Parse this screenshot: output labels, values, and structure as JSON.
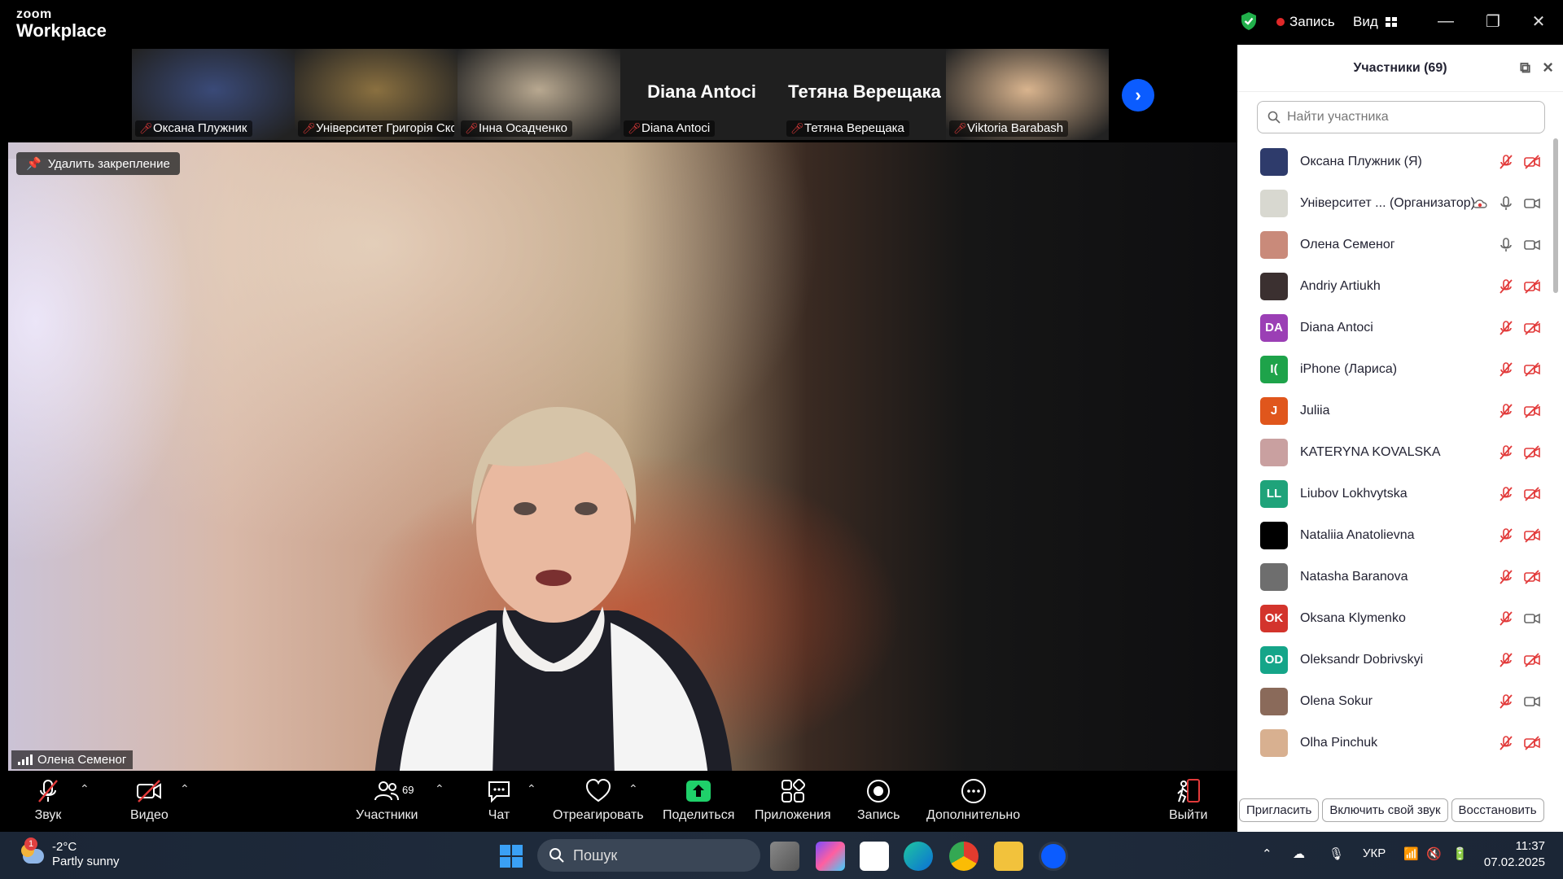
{
  "app": {
    "logo_line1": "zoom",
    "logo_line2": "Workplace",
    "record_label": "Запись",
    "view_label": "Вид"
  },
  "strip": [
    {
      "name": "Оксана Плужник",
      "kind": "photo",
      "bg": "#3a4a78"
    },
    {
      "name": "Університет Григорія Ско...",
      "kind": "photo",
      "bg": "#8a7040"
    },
    {
      "name": "Інна Осадченко",
      "kind": "photo",
      "bg": "#b8a890"
    },
    {
      "name": "Diana Antoci",
      "kind": "name",
      "big": "Diana Antoci"
    },
    {
      "name": "Тетяна Верещака",
      "kind": "name",
      "big": "Тетяна Верещака"
    },
    {
      "name": "Viktoria Barabash",
      "kind": "photo",
      "bg": "#d9b48e"
    }
  ],
  "video": {
    "unpin_label": "Удалить закрепление",
    "speaker_name": "Олена Семеног"
  },
  "toolbar": {
    "audio": "Звук",
    "video": "Видео",
    "participants": "Участники",
    "participants_count": "69",
    "chat": "Чат",
    "react": "Отреагировать",
    "share": "Поделиться",
    "apps": "Приложения",
    "record": "Запись",
    "more": "Дополнительно",
    "leave": "Выйти"
  },
  "panel": {
    "title": "Участники (69)",
    "search_placeholder": "Найти участника",
    "participants": [
      {
        "name": "Оксана Плужник (Я)",
        "initials": "",
        "color": "#2e3b6b",
        "mic": "muted",
        "cam": "off"
      },
      {
        "name": "Університет ... (Организатор)",
        "initials": "",
        "color": "#d8d8d0",
        "mic": "on",
        "cam": "on",
        "rec": true
      },
      {
        "name": "Олена Семеног",
        "initials": "",
        "color": "#c98a7a",
        "mic": "on",
        "cam": "on"
      },
      {
        "name": "Andriy Artiukh",
        "initials": "",
        "color": "#3b3030",
        "mic": "muted",
        "cam": "off"
      },
      {
        "name": "Diana Antoci",
        "initials": "DA",
        "color": "#9b3fb5",
        "mic": "muted",
        "cam": "off"
      },
      {
        "name": "iPhone (Лариса)",
        "initials": "I(",
        "color": "#1ea34a",
        "mic": "muted",
        "cam": "off"
      },
      {
        "name": "Juliia",
        "initials": "J",
        "color": "#e0561c",
        "mic": "muted",
        "cam": "off"
      },
      {
        "name": "KATERYNA KOVALSKA",
        "initials": "",
        "color": "#c9a0a0",
        "mic": "muted",
        "cam": "off"
      },
      {
        "name": "Liubov Lokhvytska",
        "initials": "LL",
        "color": "#1fa37a",
        "mic": "muted",
        "cam": "off"
      },
      {
        "name": "Nataliia Anatolievna",
        "initials": "",
        "color": "#000000",
        "mic": "muted",
        "cam": "off"
      },
      {
        "name": "Natasha Baranova",
        "initials": "",
        "color": "#6e6e6e",
        "mic": "muted",
        "cam": "off"
      },
      {
        "name": "Oksana Klymenko",
        "initials": "OK",
        "color": "#d3342c",
        "mic": "muted",
        "cam": "on"
      },
      {
        "name": "Oleksandr Dobrivskyi",
        "initials": "OD",
        "color": "#15a589",
        "mic": "muted",
        "cam": "off"
      },
      {
        "name": "Olena Sokur",
        "initials": "",
        "color": "#8a6a5a",
        "mic": "muted",
        "cam": "on"
      },
      {
        "name": "Olha Pinchuk",
        "initials": "",
        "color": "#d8b090",
        "mic": "muted",
        "cam": "off"
      }
    ],
    "invite": "Пригласить",
    "unmute_me": "Включить свой звук",
    "restore": "Восстановить"
  },
  "taskbar": {
    "weather_badge": "1",
    "temp": "-2°C",
    "condition": "Partly sunny",
    "search": "Пошук",
    "lang": "УКР",
    "time": "11:37",
    "date": "07.02.2025"
  }
}
